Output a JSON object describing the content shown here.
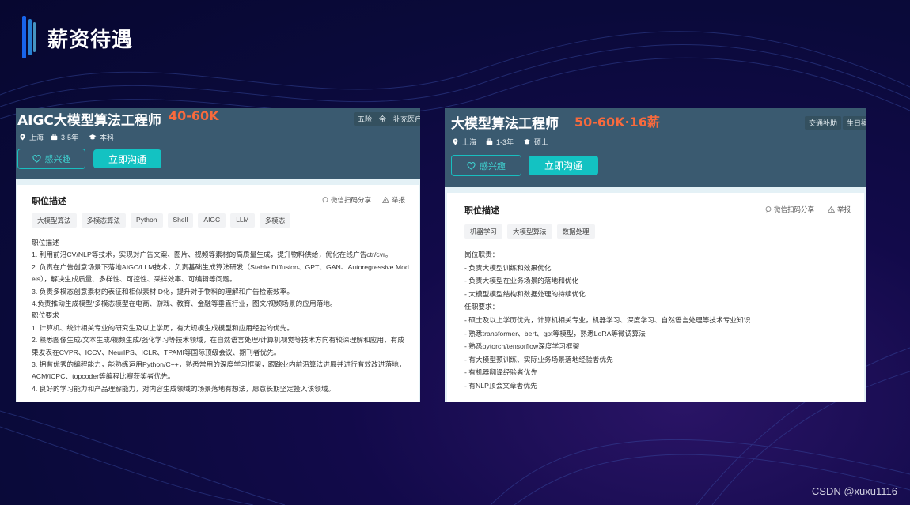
{
  "slide": {
    "title": "薪资待遇",
    "watermark": "CSDN @xuxu1116"
  },
  "left_card": {
    "job_title": "AIGC大模型算法工程师",
    "salary": "40-60K",
    "perks": [
      "五险一金",
      "补充医疗保"
    ],
    "location": "上海",
    "experience": "3-5年",
    "education": "本科",
    "interest_button": "感兴趣",
    "chat_button": "立即沟通",
    "section_title": "职位描述",
    "share_label": "微信扫码分享",
    "report_label": "举报",
    "tags": [
      "大模型算法",
      "多模态算法",
      "Python",
      "Shell",
      "AIGC",
      "LLM",
      "多模态"
    ],
    "description_lines": [
      "职位描述",
      "1. 利用前沿CV/NLP等技术，实现对广告文案、图片、视频等素材的高质量生成，提升物料供给，优化在线广告ctr/cvr。",
      "2. 负责在广告创意场景下落地AIGC/LLM技术，负责基础生成算法研发（Stable Diffusion、GPT、GAN、Autoregressive Mod",
      "els），解决生成质量、多样性、可控性、采样效率、可编辑等问题。",
      "3. 负责多模态创意素材的表征和相似素材ID化，提升对于物料的理解和广告检索效率。",
      "4.负责推动生成模型/多模态模型在电商、游戏、教育、金融等垂直行业，图文/视频场景的应用落地。",
      "职位要求",
      "1. 计算机、统计相关专业的研究生及以上学历，有大规模生成模型和应用经验的优先。",
      "2. 熟悉图像生成/文本生成/视频生成/强化学习等技术领域，在自然语言处理/计算机视觉等技术方向有较深理解和应用，有成",
      "果发表在CVPR、ICCV、NeurIPS、ICLR、TPAMI等国际顶级会议、期刊者优先。",
      "3. 拥有优秀的编程能力，能熟练运用Python/C++，熟悉常用的深度学习框架，跟踪业内前沿算法进展并进行有效改进落地，",
      "ACM/ICPC、topcoder等编程比赛获奖者优先。",
      "4. 良好的学习能力和产品理解能力，对内容生成领域的场景落地有想法，愿意长期坚定投入该领域。"
    ]
  },
  "right_card": {
    "job_title": "大模型算法工程师",
    "salary": "50-60K·16薪",
    "perks": [
      "交通补助",
      "生日福"
    ],
    "location": "上海",
    "experience": "1-3年",
    "education": "硕士",
    "interest_button": "感兴趣",
    "chat_button": "立即沟通",
    "section_title": "职位描述",
    "share_label": "微信扫码分享",
    "report_label": "举报",
    "tags": [
      "机器学习",
      "大模型算法",
      "数据处理"
    ],
    "description_lines": [
      "岗位职责：",
      "- 负责大模型训练和效果优化",
      "- 负责大模型在业务场景的落地和优化",
      "- 大模型模型结构和数据处理的持续优化",
      "任职要求：",
      "- 硕士及以上学历优先，计算机相关专业，机器学习、深度学习、自然语言处理等技术专业知识",
      "- 熟悉transformer、bert、gpt等模型，熟悉LoRA等微调算法",
      "- 熟悉pytorch/tensorflow深度学习框架",
      "- 有大模型预训练、实际业务场景落地经验者优先",
      "- 有机器翻译经验者优先",
      "- 有NLP顶会文章者优先"
    ]
  }
}
